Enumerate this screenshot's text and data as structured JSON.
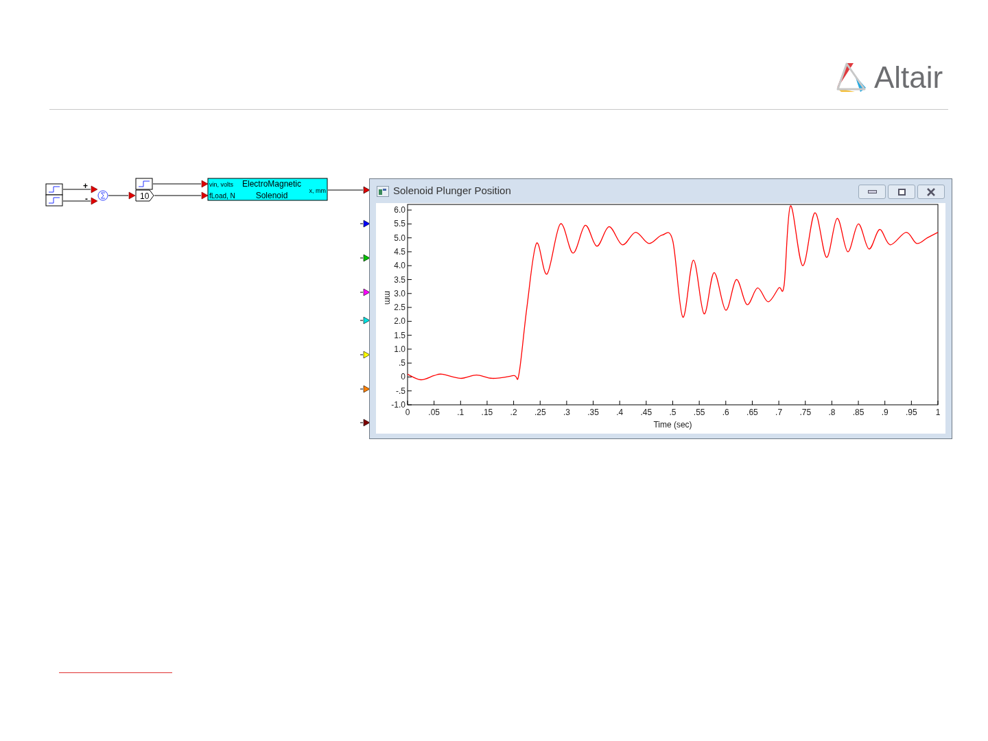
{
  "logo": {
    "text": "Altair"
  },
  "diagram": {
    "sum_signs": [
      "+",
      "-"
    ],
    "gain": {
      "value": "10"
    },
    "solenoid": {
      "inputs": [
        "vin, volts",
        "fLoad, N"
      ],
      "title_lines": [
        "ElectroMagnetic",
        "Solenoid"
      ],
      "output": "x, mm"
    }
  },
  "plot_window": {
    "title": "Solenoid Plunger Position",
    "input_ports": [
      {
        "color": "#e00000"
      },
      {
        "color": "#0000ff"
      },
      {
        "color": "#00c000"
      },
      {
        "color": "#ff00ff"
      },
      {
        "color": "#00e0e0"
      },
      {
        "color": "#ffff00"
      },
      {
        "color": "#ff8000"
      },
      {
        "color": "#800000"
      }
    ],
    "chart_data": {
      "type": "line",
      "xlabel": "Time (sec)",
      "ylabel": "mm",
      "xlim": [
        0,
        1
      ],
      "ylim": [
        -1.0,
        6.2
      ],
      "xticks": [
        0,
        {
          "value": 0.05,
          "label": ".05"
        },
        {
          "value": 0.1,
          "label": ".1"
        },
        {
          "value": 0.15,
          "label": ".15"
        },
        {
          "value": 0.2,
          "label": ".2"
        },
        {
          "value": 0.25,
          "label": ".25"
        },
        {
          "value": 0.3,
          "label": ".3"
        },
        {
          "value": 0.35,
          "label": ".35"
        },
        {
          "value": 0.4,
          "label": ".4"
        },
        {
          "value": 0.45,
          "label": ".45"
        },
        {
          "value": 0.5,
          "label": ".5"
        },
        {
          "value": 0.55,
          "label": ".55"
        },
        {
          "value": 0.6,
          "label": ".6"
        },
        {
          "value": 0.65,
          "label": ".65"
        },
        {
          "value": 0.7,
          "label": ".7"
        },
        {
          "value": 0.75,
          "label": ".75"
        },
        {
          "value": 0.8,
          "label": ".8"
        },
        {
          "value": 0.85,
          "label": ".85"
        },
        {
          "value": 0.9,
          "label": ".9"
        },
        {
          "value": 0.95,
          "label": ".95"
        },
        1
      ],
      "yticks": [
        {
          "value": 6,
          "label": "6.0"
        },
        {
          "value": 5.5,
          "label": "5.5"
        },
        {
          "value": 5,
          "label": "5.0"
        },
        {
          "value": 4.5,
          "label": "4.5"
        },
        {
          "value": 4,
          "label": "4.0"
        },
        {
          "value": 3.5,
          "label": "3.5"
        },
        {
          "value": 3,
          "label": "3.0"
        },
        {
          "value": 2.5,
          "label": "2.5"
        },
        {
          "value": 2,
          "label": "2.0"
        },
        {
          "value": 1.5,
          "label": "1.5"
        },
        {
          "value": 1,
          "label": "1.0"
        },
        {
          "value": 0.5,
          "label": ".5"
        },
        {
          "value": 0,
          "label": "0"
        },
        {
          "value": -0.5,
          "label": "-.5"
        },
        {
          "value": -1,
          "label": "-1.0"
        }
      ],
      "x": [
        0,
        0.025,
        0.05,
        0.065,
        0.1,
        0.13,
        0.16,
        0.2,
        0.21,
        0.225,
        0.243,
        0.263,
        0.288,
        0.312,
        0.335,
        0.357,
        0.38,
        0.405,
        0.43,
        0.455,
        0.48,
        0.5,
        0.519,
        0.539,
        0.559,
        0.578,
        0.6,
        0.62,
        0.64,
        0.66,
        0.68,
        0.7,
        0.71,
        0.722,
        0.745,
        0.768,
        0.79,
        0.81,
        0.83,
        0.85,
        0.87,
        0.89,
        0.91,
        0.94,
        0.96,
        0.98,
        1.0
      ],
      "series": [
        {
          "color": "#ff0000",
          "values": [
            0.1,
            -0.1,
            0.05,
            0.1,
            -0.05,
            0.07,
            -0.05,
            0.05,
            0.1,
            2.5,
            4.8,
            3.7,
            5.5,
            4.45,
            5.45,
            4.7,
            5.4,
            4.75,
            5.2,
            4.8,
            5.1,
            4.9,
            2.15,
            4.2,
            2.27,
            3.75,
            2.4,
            3.5,
            2.6,
            3.2,
            2.7,
            3.2,
            3.3,
            6.15,
            4.0,
            5.9,
            4.3,
            5.7,
            4.5,
            5.5,
            4.6,
            5.3,
            4.75,
            5.2,
            4.8,
            5.0,
            5.2
          ]
        }
      ]
    }
  }
}
